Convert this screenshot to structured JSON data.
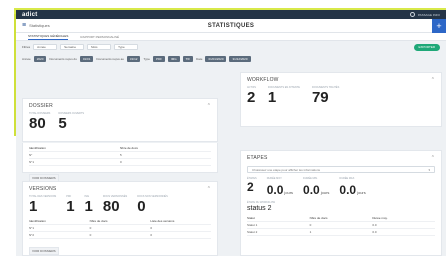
{
  "topbar": {
    "logo": "adict",
    "user": "PASSAGE INFO"
  },
  "titlebar": {
    "brand": "Statistiques",
    "title": "STATISTIQUES",
    "add": "+"
  },
  "tabs": [
    {
      "label": "STATISTIQUES GÉNÉRALES"
    },
    {
      "label": "RAPPORT PERSONNALISÉ"
    }
  ],
  "filters": {
    "label": "Filtres",
    "fields": [
      "Année",
      "Semaine",
      "Mois",
      "Type"
    ],
    "export": "EXPORTER"
  },
  "filters2": {
    "year_label": "Année",
    "year": "2020",
    "docs_from_label": "Documents reçus du",
    "docs_from": "01/01",
    "docs_to_label": "Documents reçus au",
    "docs_to": "31/12",
    "type_label": "Type",
    "type_chips": [
      "PDF",
      "IMG",
      "TIF"
    ],
    "date_label": "Date",
    "date_from": "01/01/2020",
    "date_to": "31/12/2020"
  },
  "dossier": {
    "title": "DOSSIER",
    "caps": [
      "TOTAL DOSSIERS",
      "DOSSIERS OUVERTS"
    ],
    "values": [
      "80",
      "5"
    ],
    "headers": [
      "Identification",
      "Nbre de docs"
    ],
    "rows": [
      [
        "N°",
        "5"
      ],
      [
        "N°1",
        "0"
      ]
    ],
    "link": "VOIR DOSSIERS"
  },
  "versions": {
    "title": "VERSIONS",
    "caps": [
      "TOTAL DES VERSIONS",
      "PDF",
      "IMG",
      "DOCS VERSIONNÉS",
      "DOCS NON VERSIONNÉS"
    ],
    "values": [
      "1",
      "1",
      "1",
      "80",
      "0"
    ],
    "headers": [
      "Identification",
      "Nbre de docs",
      "Liste des versions"
    ],
    "rows": [
      [
        "N°1",
        "0",
        "0"
      ],
      [
        "N°2",
        "0",
        "0"
      ]
    ],
    "link": "VOIR DOSSIERS"
  },
  "workflow": {
    "title": "WORKFLOW",
    "caps": [
      "ACTIFS",
      "DOCUMENTS EN ATTENTE",
      "DOCUMENTS TRAITÉS"
    ],
    "values": [
      "2",
      "1",
      "79"
    ]
  },
  "etapes": {
    "title": "ETAPES",
    "select_placeholder": "Choisissez une étape pour afficher les informations",
    "caps": [
      "ÉTAPES",
      "DURÉE MOY.",
      "DURÉE MIN.",
      "DURÉE MAX."
    ],
    "values": [
      "2",
      "0.0",
      "0.0",
      "0.0"
    ],
    "unit": "jours",
    "status_cap": "ÉTAPE DU WORKFLOW",
    "status": "status 2",
    "headers": [
      "Statut",
      "Nbre de docs",
      "Durée moy."
    ],
    "rows": [
      [
        "Statut 1",
        "0",
        "0.0"
      ],
      [
        "Statut 2",
        "1",
        "0.0"
      ]
    ]
  },
  "colors": {
    "accent": "#2d67c7",
    "green": "#1fa878",
    "yellow": "#cfe03a",
    "dark": "#243447"
  },
  "icons": [
    "menu-icon",
    "user-icon",
    "chevron-up-icon",
    "plus-icon"
  ]
}
